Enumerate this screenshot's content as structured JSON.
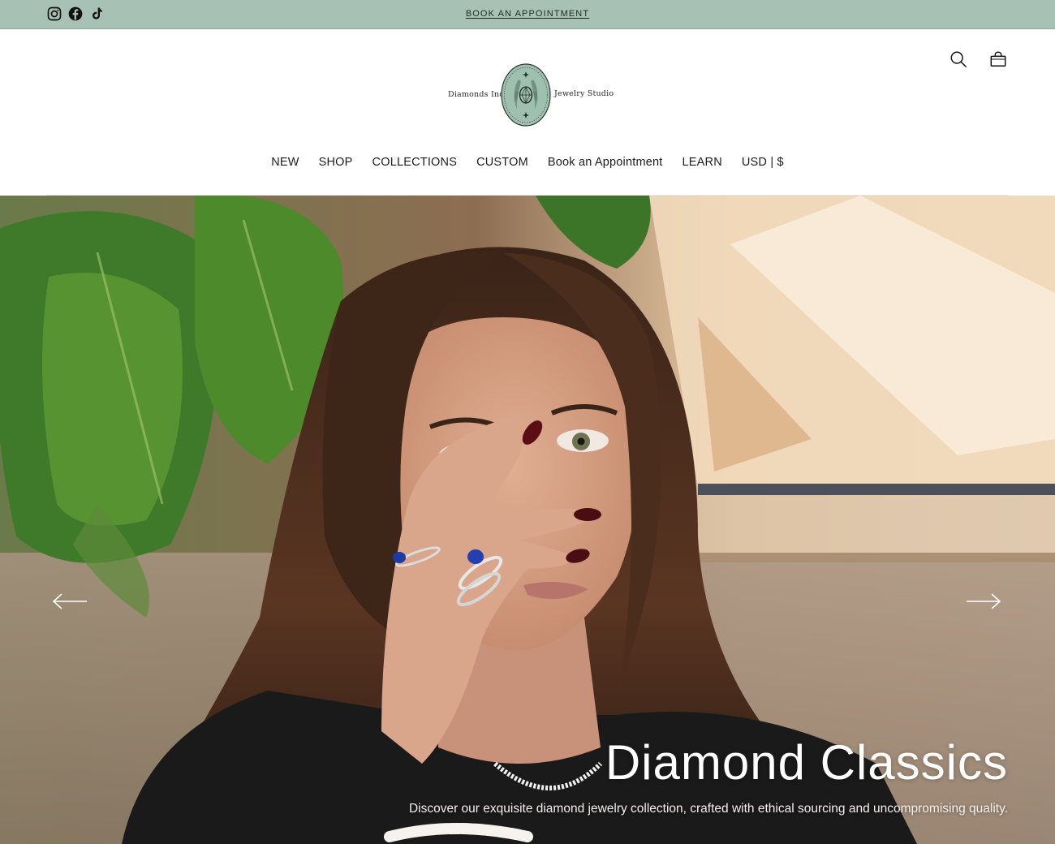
{
  "announcement": {
    "text": "BOOK AN APPOINTMENT"
  },
  "social": {
    "icons": [
      "instagram-icon",
      "facebook-icon",
      "tiktok-icon"
    ]
  },
  "logo": {
    "left_text": "Diamonds Inc",
    "right_text": "Jewelry Studio"
  },
  "header": {
    "icons": [
      "search-icon",
      "cart-icon"
    ]
  },
  "nav": {
    "items": [
      "NEW",
      "SHOP",
      "COLLECTIONS",
      "CUSTOM",
      "Book an Appointment",
      "LEARN",
      "USD | $"
    ]
  },
  "hero": {
    "title": "Diamond Classics",
    "subtitle": "Discover our exquisite diamond jewelry collection, crafted with ethical sourcing and uncompromising quality."
  },
  "colors": {
    "topbar": "#a7c1b4",
    "logo_badge": "#9fc0ae",
    "text": "#1c1c1c"
  }
}
